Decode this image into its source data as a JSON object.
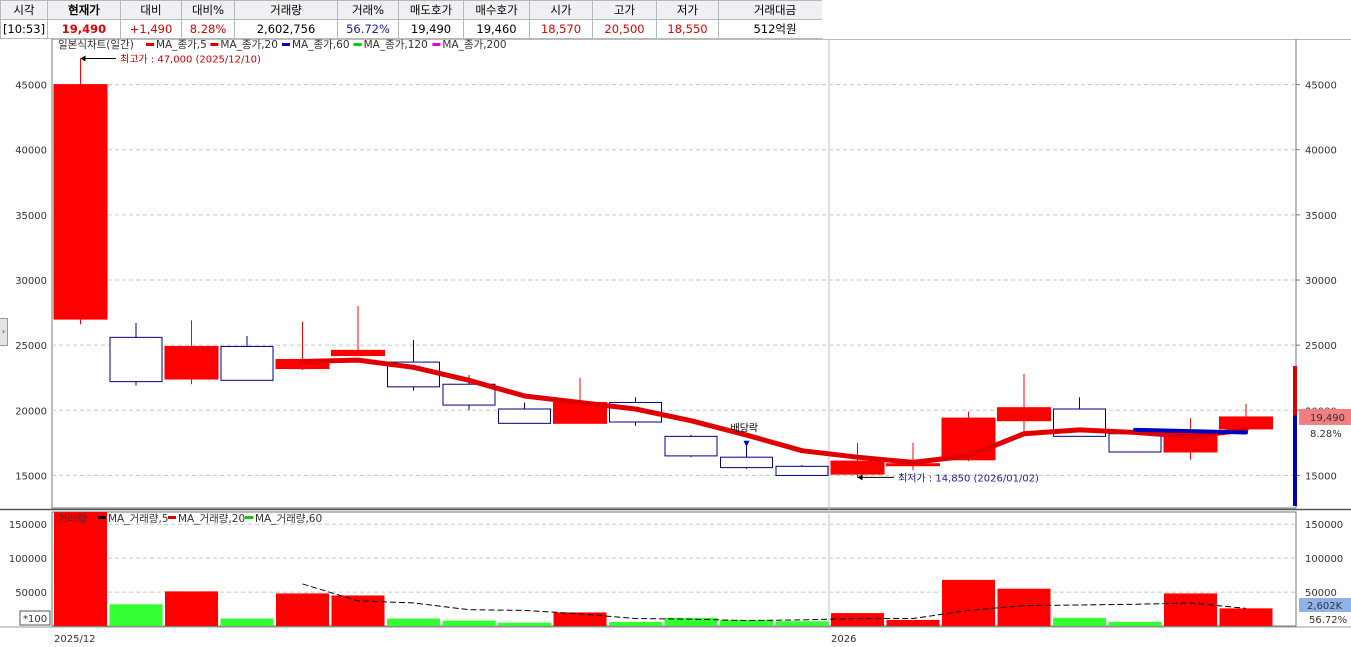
{
  "quote": {
    "headers": [
      "시각",
      "현재가",
      "대비",
      "대비%",
      "거래량",
      "거래%",
      "매도호가",
      "매수호가",
      "시가",
      "고가",
      "저가",
      "거래대금"
    ],
    "values": [
      "[10:53]",
      "19,490",
      "+1,490",
      "8.28%",
      "2,602,756",
      "56.72%",
      "19,490",
      "19,460",
      "18,570",
      "20,500",
      "18,550",
      "512억원"
    ]
  },
  "price_panel": {
    "legend": {
      "title": "일본식차트(일간)",
      "items": [
        {
          "label": "MA_종가,5",
          "color": "#e00000"
        },
        {
          "label": "MA_종가,20",
          "color": "#e00000"
        },
        {
          "label": "MA_종가,60",
          "color": "#0000c0"
        },
        {
          "label": "MA_종가,120",
          "color": "#00d000"
        },
        {
          "label": "MA_종가,200",
          "color": "#e000e0"
        }
      ]
    },
    "high_note": "최고가 : 47,000 (2025/12/10)",
    "low_note": "최저가 : 14,850 (2026/01/02)",
    "event_note": "배당락",
    "price_badge": "19,490",
    "pct_badge": "8.28%"
  },
  "volume_panel": {
    "legend": {
      "title": "거래량",
      "items": [
        {
          "label": "MA_거래량,5",
          "color": "#000000"
        },
        {
          "label": "MA_거래량,20",
          "color": "#e00000"
        },
        {
          "label": "MA_거래량,60",
          "color": "#00d000"
        }
      ]
    },
    "unit": "*100",
    "vol_badge": "2,602K",
    "pct_badge": "56.72%"
  },
  "x_axis": {
    "labels": [
      "2025/12",
      "2026"
    ]
  },
  "colors": {
    "up": "#ff0000",
    "down_border": "#00008b",
    "vol_up": "#ff0000",
    "vol_down": "#33ff33",
    "ma": "#e00000",
    "ma_blue": "#0000c0"
  },
  "chart_data": [
    {
      "type": "candlestick",
      "ylim": [
        12500,
        48500
      ],
      "yticks": [
        15000,
        20000,
        25000,
        30000,
        35000,
        40000,
        45000
      ],
      "candles": [
        {
          "o": 27000,
          "h": 47000,
          "l": 26600,
          "c": 45000
        },
        {
          "o": 25600,
          "h": 26700,
          "l": 21900,
          "c": 22200
        },
        {
          "o": 22400,
          "h": 26900,
          "l": 22000,
          "c": 24900
        },
        {
          "o": 24900,
          "h": 25700,
          "l": 22300,
          "c": 22300
        },
        {
          "o": 23200,
          "h": 26800,
          "l": 23100,
          "c": 23900
        },
        {
          "o": 24200,
          "h": 28000,
          "l": 24200,
          "c": 24600
        },
        {
          "o": 23700,
          "h": 25400,
          "l": 21500,
          "c": 21800
        },
        {
          "o": 22000,
          "h": 22700,
          "l": 20000,
          "c": 20400
        },
        {
          "o": 20100,
          "h": 20600,
          "l": 19000,
          "c": 19000
        },
        {
          "o": 19000,
          "h": 22500,
          "l": 19000,
          "c": 20600
        },
        {
          "o": 20600,
          "h": 21000,
          "l": 18800,
          "c": 19100
        },
        {
          "o": 18000,
          "h": 18100,
          "l": 16400,
          "c": 16500
        },
        {
          "o": 16400,
          "h": 17300,
          "l": 15500,
          "c": 15600
        },
        {
          "o": 15700,
          "h": 15800,
          "l": 15000,
          "c": 15000
        },
        {
          "o": 15100,
          "h": 17500,
          "l": 14850,
          "c": 16100
        },
        {
          "o": 15800,
          "h": 17500,
          "l": 15400,
          "c": 15900
        },
        {
          "o": 16200,
          "h": 19900,
          "l": 16100,
          "c": 19400
        },
        {
          "o": 19200,
          "h": 22800,
          "l": 18200,
          "c": 20200
        },
        {
          "o": 20100,
          "h": 21000,
          "l": 18000,
          "c": 18000
        },
        {
          "o": 18200,
          "h": 18600,
          "l": 16800,
          "c": 16800
        },
        {
          "o": 16800,
          "h": 19400,
          "l": 16200,
          "c": 18400
        },
        {
          "o": 18570,
          "h": 20500,
          "l": 18550,
          "c": 19490
        }
      ],
      "ma_line": [
        null,
        null,
        null,
        null,
        23750,
        23850,
        23300,
        22300,
        21100,
        20600,
        20100,
        19200,
        18100,
        16900,
        16400,
        16000,
        16500,
        18200,
        18500,
        18300,
        18000,
        18500
      ],
      "ma_line_blue": [
        null,
        null,
        null,
        null,
        null,
        null,
        null,
        null,
        null,
        null,
        null,
        null,
        null,
        null,
        null,
        null,
        null,
        null,
        null,
        18500,
        18400,
        18300
      ]
    },
    {
      "type": "bar",
      "ylim": [
        0,
        168000
      ],
      "yticks": [
        50000,
        100000,
        150000
      ],
      "values": [
        168000,
        32000,
        51000,
        11000,
        48000,
        45000,
        11000,
        8000,
        5000,
        20000,
        6000,
        12000,
        9000,
        7000,
        19000,
        9000,
        68000,
        55000,
        12000,
        6000,
        48000,
        26000
      ],
      "ma_line": [
        null,
        null,
        null,
        null,
        62000,
        37000,
        34000,
        24000,
        23000,
        18000,
        11000,
        10000,
        8000,
        9000,
        11000,
        11000,
        23000,
        30000,
        31000,
        32000,
        34000,
        26000
      ]
    }
  ]
}
